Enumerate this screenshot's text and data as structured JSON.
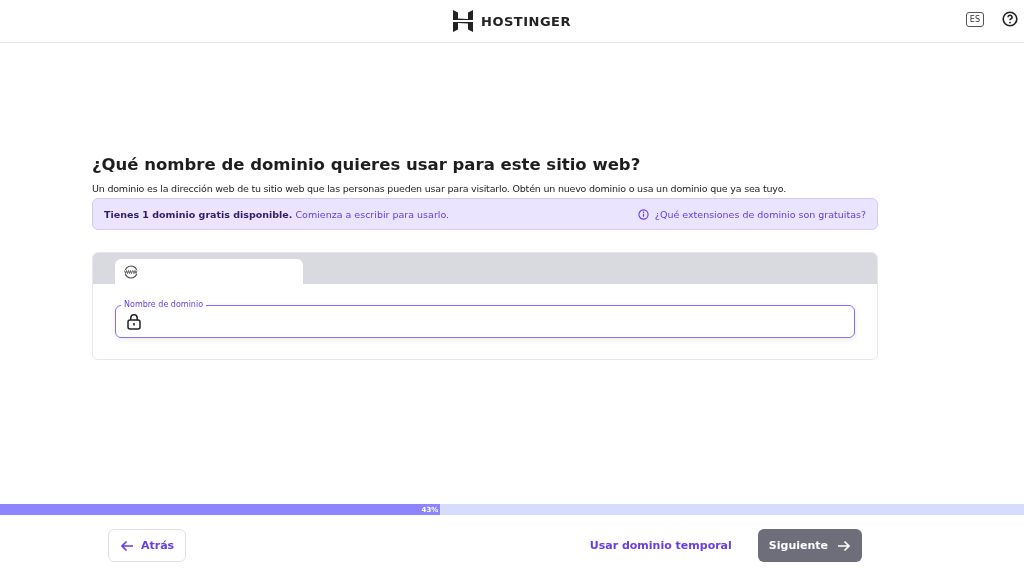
{
  "header": {
    "logo_text": "HOSTINGER",
    "language": "ES"
  },
  "title": "¿Qué nombre de dominio quieres usar para este sitio web?",
  "description": "Un dominio es la dirección web de tu sitio web que las personas pueden usar para visitarlo. Obtén un nuevo dominio o usa un dominio que ya sea tuyo.",
  "notice": {
    "text": "**Tienes 1 dominio gratis disponible.** Comienza a escribir para usarlo.",
    "link": "¿Qué extensiones de dominio son gratuitas?"
  },
  "tabs": [
    {
      "kind": "www",
      "selected": true
    }
  ],
  "domain_field": {
    "label": "Nombre de dominio",
    "focused": true
  },
  "progress": {
    "level": 0.43,
    "reading": "43%"
  },
  "footer": {
    "back": "Atrás",
    "temporary": "Usar dominio temporal",
    "next": "Siguiente",
    "next_disabled": true
  }
}
